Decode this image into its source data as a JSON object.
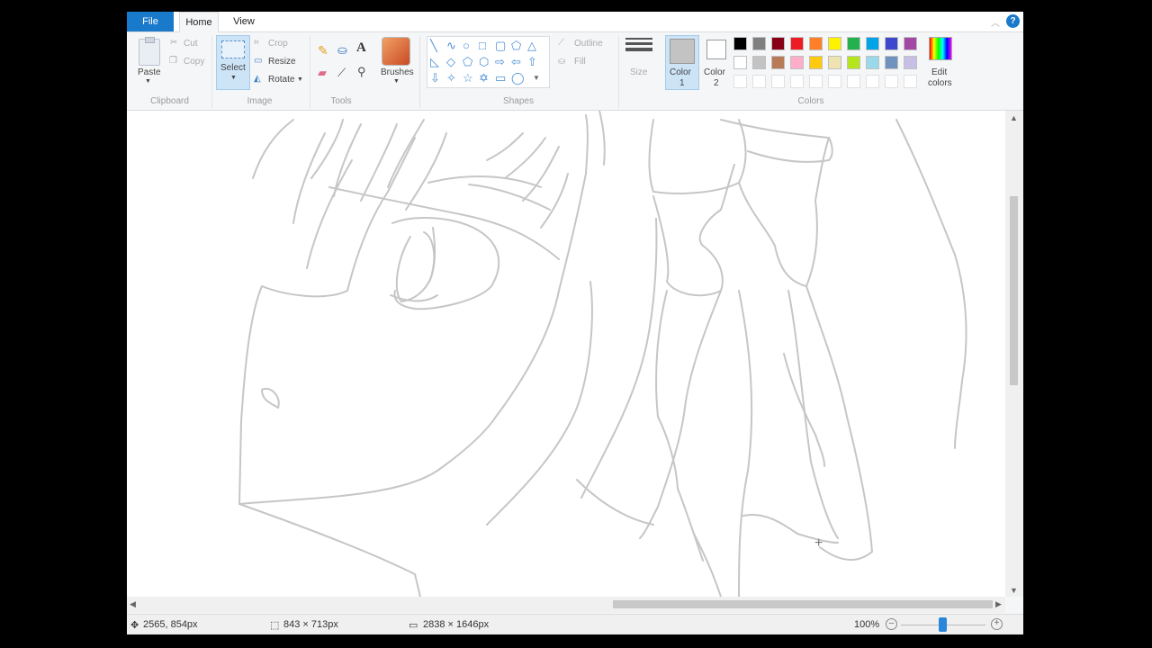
{
  "tabs": {
    "file": "File",
    "home": "Home",
    "view": "View"
  },
  "help": "?",
  "clipboard": {
    "paste": "Paste",
    "cut": "Cut",
    "copy": "Copy",
    "group": "Clipboard"
  },
  "image": {
    "select": "Select",
    "crop": "Crop",
    "resize": "Resize",
    "rotate": "Rotate",
    "group": "Image"
  },
  "tools": {
    "group": "Tools"
  },
  "brushes": {
    "label": "Brushes"
  },
  "shapes": {
    "outline": "Outline",
    "fill": "Fill",
    "group": "Shapes"
  },
  "size": {
    "label": "Size"
  },
  "colors": {
    "color1_label": "Color\n1",
    "color1_a": "Color",
    "color1_b": "1",
    "color2_a": "Color",
    "color2_b": "2",
    "edit_a": "Edit",
    "edit_b": "colors",
    "group": "Colors",
    "color1_value": "#c3c3c3",
    "color2_value": "#ffffff",
    "palette_row1": [
      "#000000",
      "#7f7f7f",
      "#880015",
      "#ed1c24",
      "#ff7f27",
      "#fff200",
      "#22b14c",
      "#00a2e8",
      "#3f48cc",
      "#a349a4"
    ],
    "palette_row2": [
      "#ffffff",
      "#c3c3c3",
      "#b97a57",
      "#ffaec9",
      "#ffc90e",
      "#efe4b0",
      "#b5e61d",
      "#99d9ea",
      "#7092be",
      "#c8bfe7"
    ]
  },
  "status": {
    "cursor_pos": "2565, 854px",
    "selection_size": "843 × 713px",
    "canvas_size": "2838 × 1646px",
    "zoom": "100%"
  }
}
